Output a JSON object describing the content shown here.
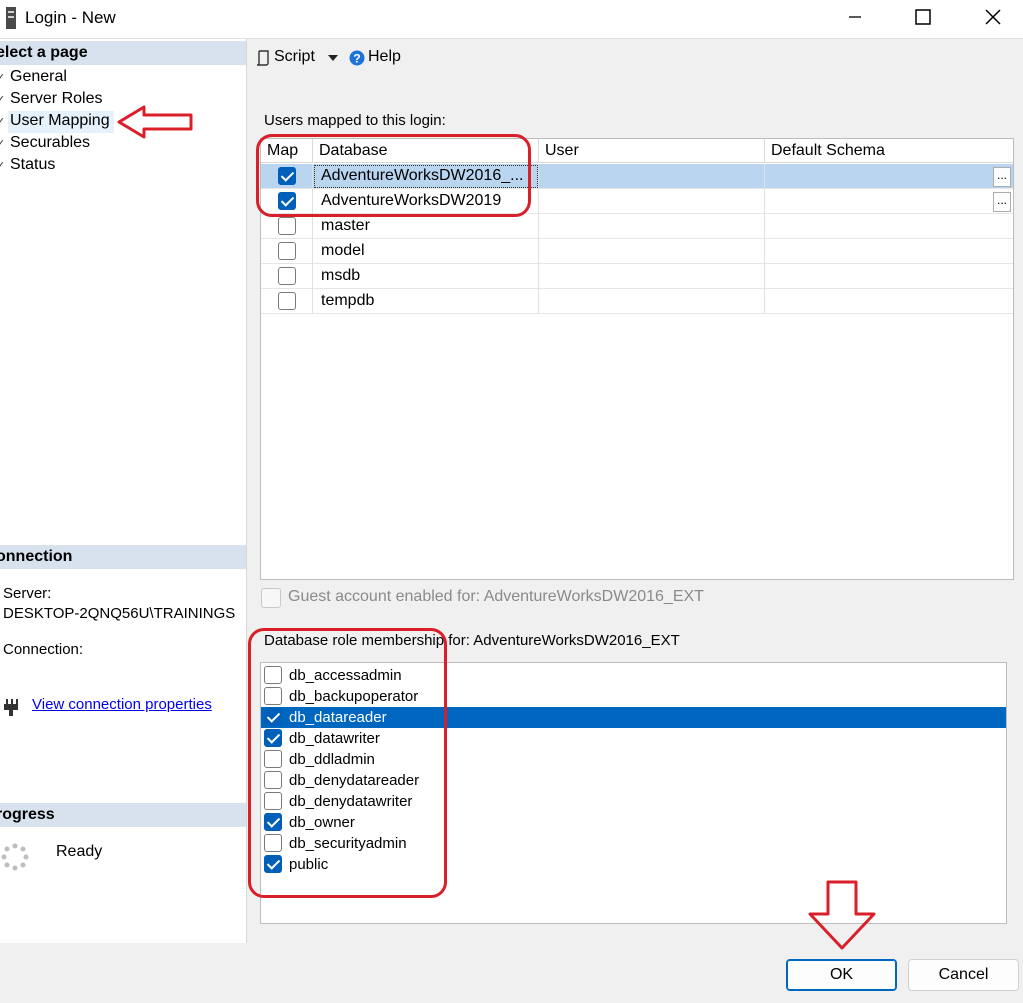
{
  "window": {
    "title": "Login - New",
    "minimize_glyph": "—",
    "maximize_glyph": "☐",
    "close_glyph": "✕"
  },
  "left": {
    "select_page_header": "elect a page",
    "pages": [
      {
        "label": "General"
      },
      {
        "label": "Server Roles"
      },
      {
        "label": "User Mapping"
      },
      {
        "label": "Securables"
      },
      {
        "label": "Status"
      }
    ],
    "connection_header": "onnection",
    "server_label": "Server:",
    "server_value": "DESKTOP-2QNQ56U\\TRAININGS",
    "connection_label": "Connection:",
    "view_connection_link": "View connection properties",
    "progress_header": "rogress",
    "progress_status": "Ready"
  },
  "toolbar": {
    "script_label": "Script",
    "help_label": "Help"
  },
  "users_mapped": {
    "label": "Users mapped to this login:",
    "columns": [
      "Map",
      "Database",
      "User",
      "Default Schema"
    ],
    "rows": [
      {
        "mapped": true,
        "database": "AdventureWorksDW2016_...",
        "user": "",
        "schema": "",
        "selected": true
      },
      {
        "mapped": true,
        "database": "AdventureWorksDW2019",
        "user": "",
        "schema": ""
      },
      {
        "mapped": false,
        "database": "master",
        "user": "",
        "schema": ""
      },
      {
        "mapped": false,
        "database": "model",
        "user": "",
        "schema": ""
      },
      {
        "mapped": false,
        "database": "msdb",
        "user": "",
        "schema": ""
      },
      {
        "mapped": false,
        "database": "tempdb",
        "user": "",
        "schema": ""
      }
    ],
    "ellipsis": "..."
  },
  "guest": {
    "label": "Guest account enabled for: AdventureWorksDW2016_EXT",
    "checked": false
  },
  "roles": {
    "label": "Database role membership for: AdventureWorksDW2016_EXT",
    "items": [
      {
        "name": "db_accessadmin",
        "checked": false
      },
      {
        "name": "db_backupoperator",
        "checked": false
      },
      {
        "name": "db_datareader",
        "checked": true,
        "selected": true
      },
      {
        "name": "db_datawriter",
        "checked": true
      },
      {
        "name": "db_ddladmin",
        "checked": false
      },
      {
        "name": "db_denydatareader",
        "checked": false
      },
      {
        "name": "db_denydatawriter",
        "checked": false
      },
      {
        "name": "db_owner",
        "checked": true
      },
      {
        "name": "db_securityadmin",
        "checked": false
      },
      {
        "name": "public",
        "checked": true
      }
    ]
  },
  "buttons": {
    "ok": "OK",
    "cancel": "Cancel"
  },
  "colors": {
    "annotation_red": "#d9202a",
    "selection_blue": "#0067c0",
    "checkbox_blue": "#005fb8"
  }
}
